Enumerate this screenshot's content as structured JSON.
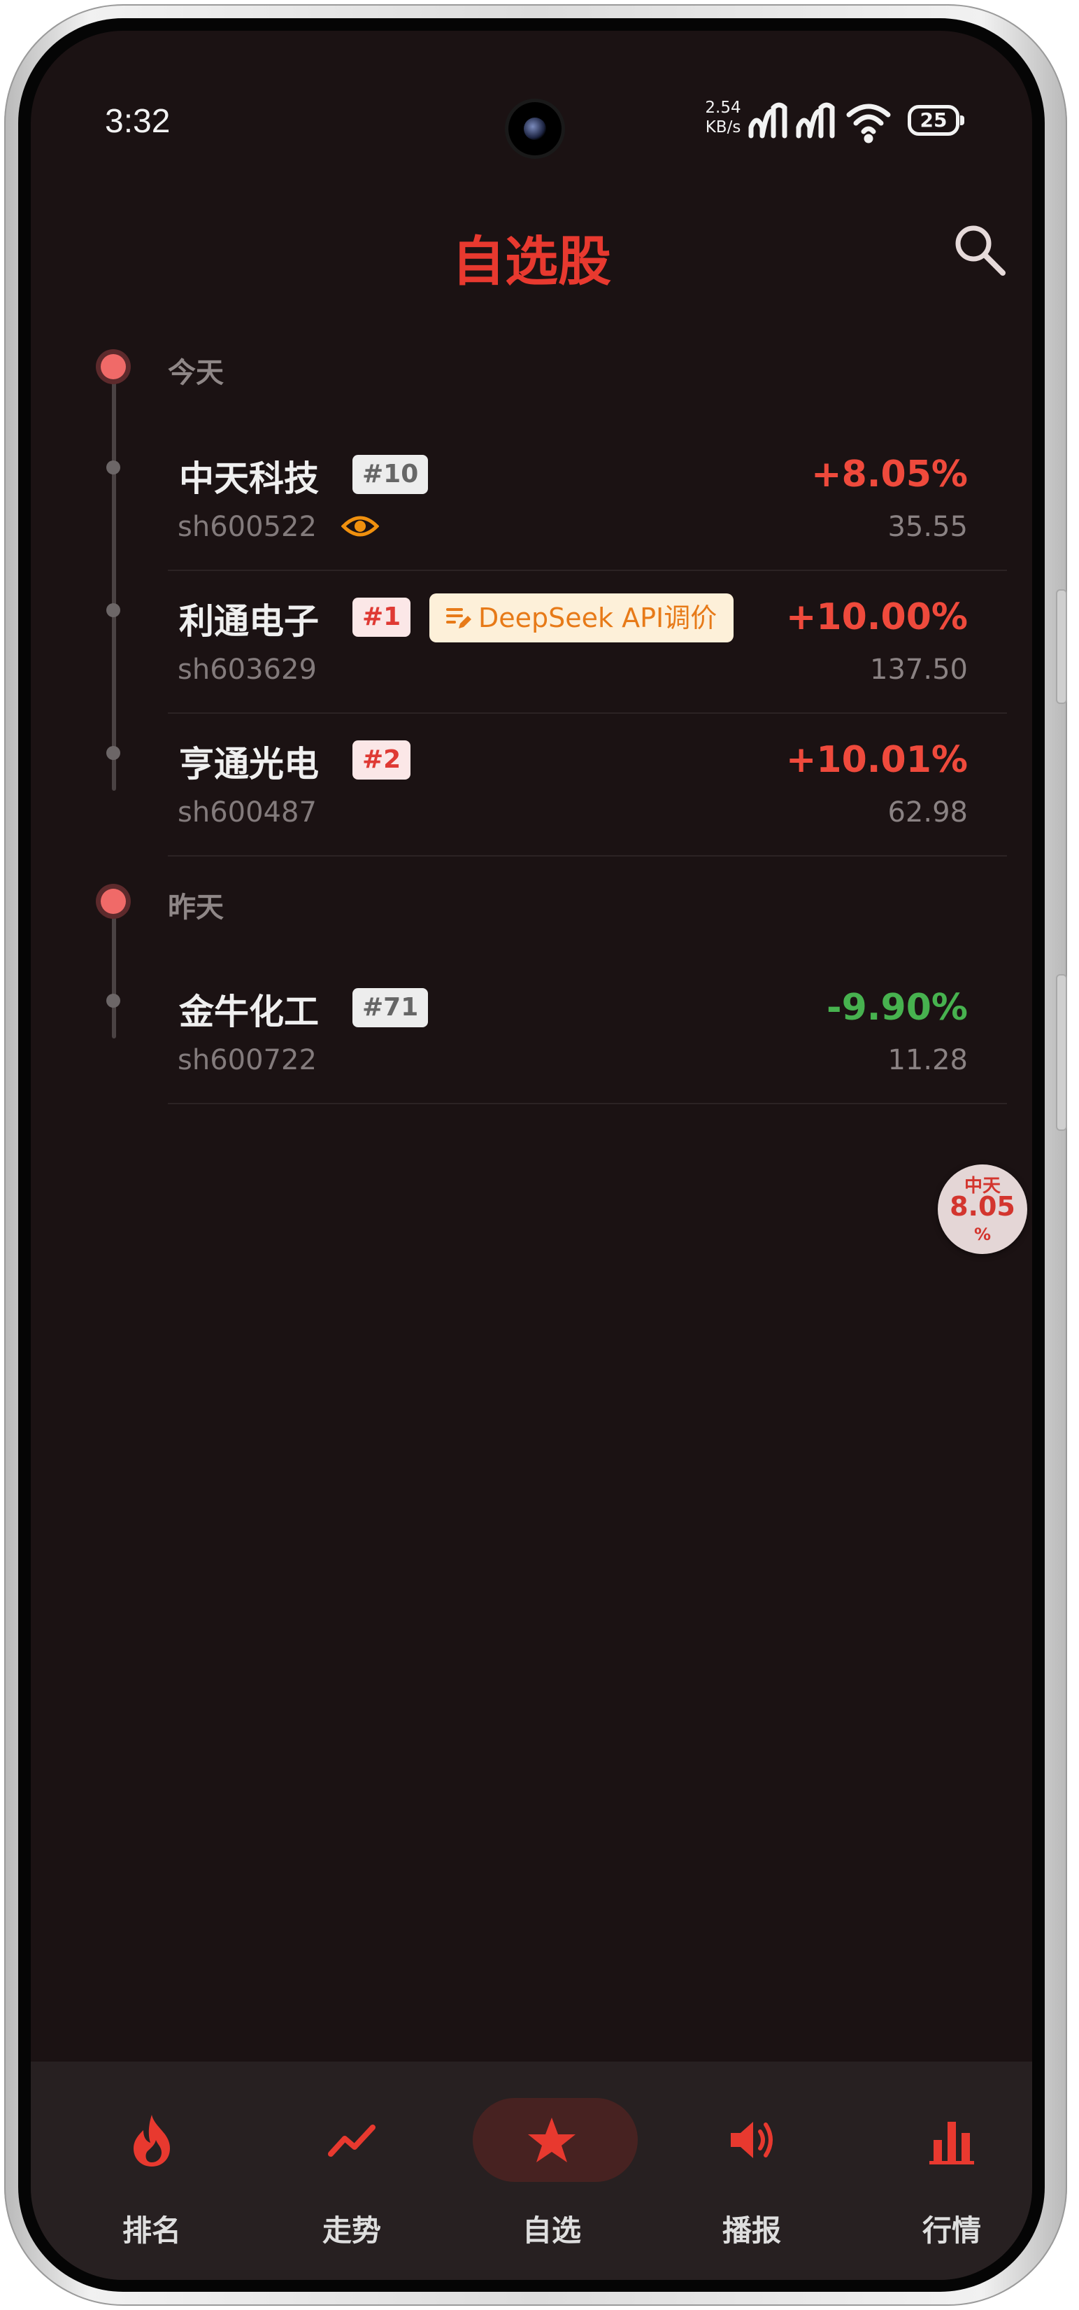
{
  "status_bar": {
    "time": "3:32",
    "net_speed_value": "2.54",
    "net_speed_unit": "KB/s",
    "battery": "25",
    "icons": [
      "signal-icon",
      "signal-icon",
      "wifi-icon",
      "battery-icon"
    ]
  },
  "header": {
    "title": "自选股",
    "search_icon": "search-icon"
  },
  "groups": [
    {
      "date": "今天",
      "items": [
        {
          "name": "中天科技",
          "rank": "#10",
          "code": "sh600522",
          "change": "+8.05%",
          "price": "35.55",
          "watch_icon": "eye-icon"
        },
        {
          "name": "利通电子",
          "rank": "#1",
          "code": "sh603629",
          "change": "+10.00%",
          "price": "137.50",
          "tag": "DeepSeek API调价",
          "tag_icon": "notes-pen-icon"
        },
        {
          "name": "亨通光电",
          "rank": "#2",
          "code": "sh600487",
          "change": "+10.01%",
          "price": "62.98"
        }
      ]
    },
    {
      "date": "昨天",
      "items": [
        {
          "name": "金牛化工",
          "rank": "#71",
          "code": "sh600722",
          "change": "-9.90%",
          "price": "11.28"
        }
      ]
    }
  ],
  "float_bubble": {
    "name": "中天",
    "value": "8.05",
    "unit": "%"
  },
  "bottom_nav": [
    {
      "label": "排名",
      "icon": "flame-icon"
    },
    {
      "label": "走势",
      "icon": "trend-line-icon"
    },
    {
      "label": "自选",
      "icon": "star-icon",
      "active": true
    },
    {
      "label": "播报",
      "icon": "speaker-icon"
    },
    {
      "label": "行情",
      "icon": "bar-chart-icon"
    }
  ],
  "colors": {
    "accent": "#e8392f",
    "up": "#ef4a3c",
    "down": "#47b24f",
    "background": "#1b1213"
  }
}
